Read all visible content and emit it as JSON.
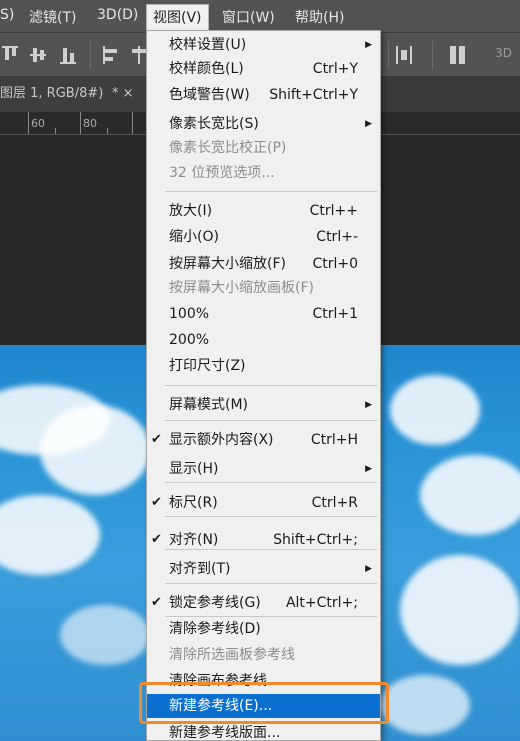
{
  "menubar": {
    "items": [
      {
        "label": "S)"
      },
      {
        "label": "滤镜(T)"
      },
      {
        "label": "3D(D)"
      },
      {
        "label": "视图(V)",
        "active": true
      },
      {
        "label": "窗口(W)"
      },
      {
        "label": "帮助(H)"
      }
    ]
  },
  "options_bar": {
    "label_3d": "3D"
  },
  "document": {
    "tab_title": "图层 1, RGB/8#)",
    "tab_modified_close": "*  ×"
  },
  "ruler": {
    "labels": [
      "60",
      "80"
    ]
  },
  "view_menu": {
    "items": [
      {
        "label": "校样设置(U)",
        "shortcut": "",
        "submenu": true
      },
      {
        "label": "校样颜色(L)",
        "shortcut": "Ctrl+Y"
      },
      {
        "label": "色域警告(W)",
        "shortcut": "Shift+Ctrl+Y"
      },
      {
        "label": "像素长宽比(S)",
        "shortcut": "",
        "submenu": true
      },
      {
        "label": "像素长宽比校正(P)",
        "shortcut": "",
        "disabled": true
      },
      {
        "label": "32 位预览选项...",
        "shortcut": "",
        "disabled": true
      },
      {
        "label": "放大(I)",
        "shortcut": "Ctrl++"
      },
      {
        "label": "缩小(O)",
        "shortcut": "Ctrl+-"
      },
      {
        "label": "按屏幕大小缩放(F)",
        "shortcut": "Ctrl+0"
      },
      {
        "label": "按屏幕大小缩放画板(F)",
        "shortcut": "",
        "disabled": true
      },
      {
        "label": "100%",
        "shortcut": "Ctrl+1"
      },
      {
        "label": "200%",
        "shortcut": ""
      },
      {
        "label": "打印尺寸(Z)",
        "shortcut": ""
      },
      {
        "label": "屏幕模式(M)",
        "shortcut": "",
        "submenu": true
      },
      {
        "label": "显示额外内容(X)",
        "shortcut": "Ctrl+H",
        "checked": true
      },
      {
        "label": "显示(H)",
        "shortcut": "",
        "submenu": true
      },
      {
        "label": "标尺(R)",
        "shortcut": "Ctrl+R",
        "checked": true
      },
      {
        "label": "对齐(N)",
        "shortcut": "Shift+Ctrl+;",
        "checked": true
      },
      {
        "label": "对齐到(T)",
        "shortcut": "",
        "submenu": true
      },
      {
        "label": "锁定参考线(G)",
        "shortcut": "Alt+Ctrl+;",
        "checked": true
      },
      {
        "label": "清除参考线(D)",
        "shortcut": ""
      },
      {
        "label": "清除所选画板参考线",
        "shortcut": "",
        "disabled": true
      },
      {
        "label": "清除画布参考线",
        "shortcut": ""
      },
      {
        "label": "新建参考线(E)...",
        "shortcut": "",
        "highlighted": true
      },
      {
        "label": "新建参考线版面...",
        "shortcut": ""
      }
    ]
  },
  "colors": {
    "menu_bg": "#f0f0f0",
    "highlight": "#0a6fcf",
    "annotation_outline": "#f08a2a",
    "app_bg": "#535353"
  }
}
